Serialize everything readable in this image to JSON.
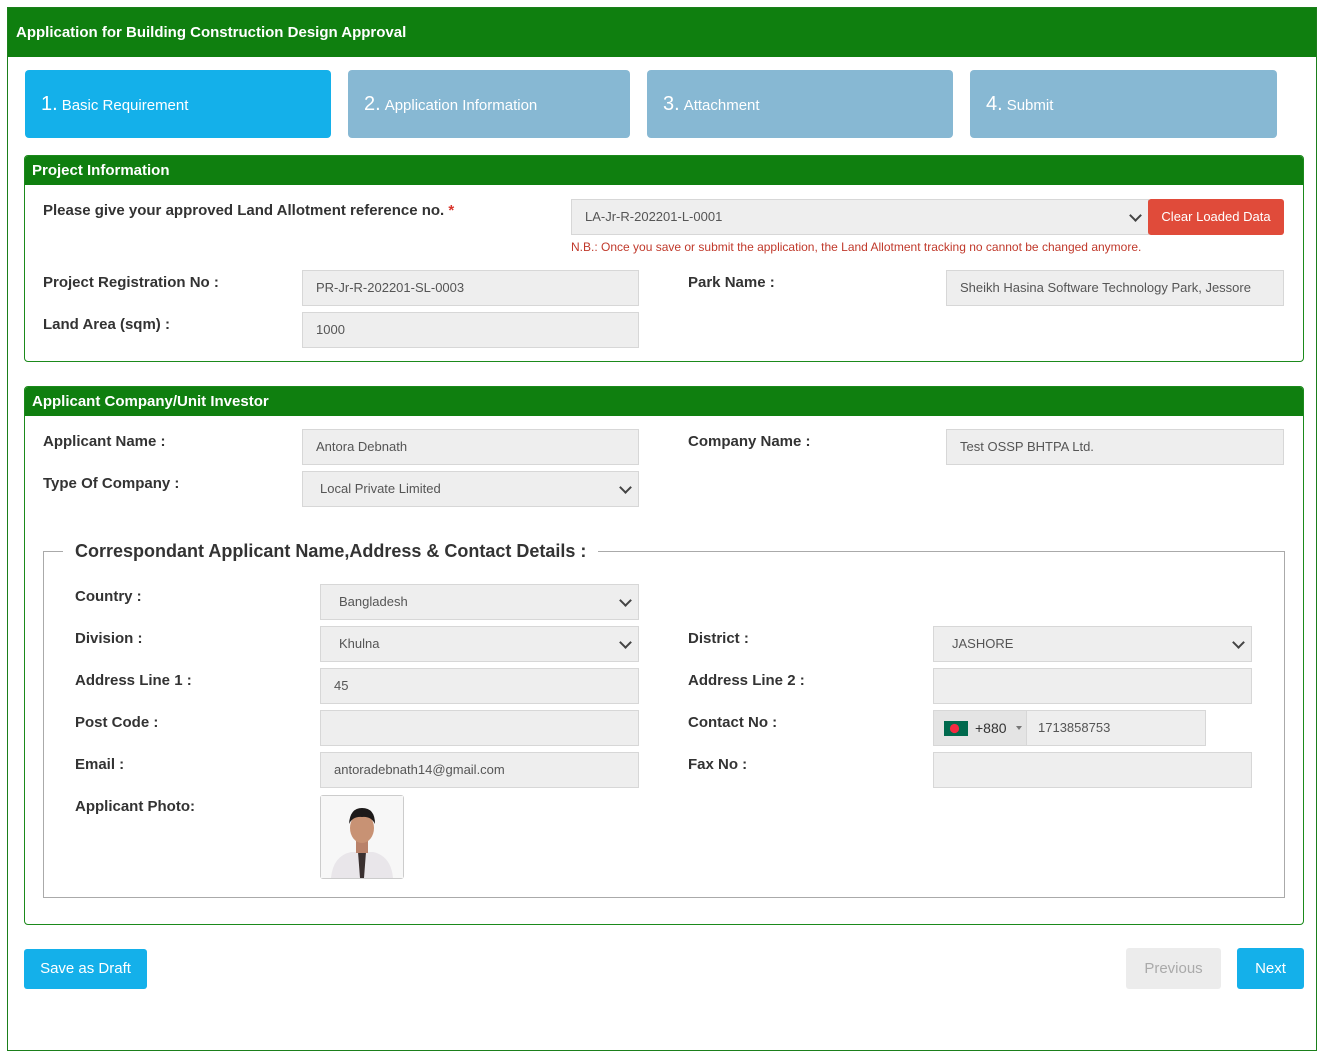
{
  "header": {
    "title": "Application for Building Construction Design Approval"
  },
  "steps": [
    {
      "num": "1.",
      "label": "Basic Requirement",
      "active": true
    },
    {
      "num": "2.",
      "label": "Application Information",
      "active": false
    },
    {
      "num": "3.",
      "label": "Attachment",
      "active": false
    },
    {
      "num": "4.",
      "label": "Submit",
      "active": false
    }
  ],
  "project": {
    "title": "Project Information",
    "land_ref_label": "Please give your approved Land Allotment reference no.",
    "required_mark": "*",
    "land_ref_value": "LA-Jr-R-202201-L-0001",
    "clear_button": "Clear Loaded Data",
    "note": "N.B.: Once you save or submit the application, the Land Allotment tracking no cannot be changed anymore.",
    "reg_no_label": "Project Registration No :",
    "reg_no_value": "PR-Jr-R-202201-SL-0003",
    "park_label": "Park Name :",
    "park_value": "Sheikh Hasina Software Technology Park, Jessore",
    "land_area_label": "Land Area (sqm) :",
    "land_area_value": "1000"
  },
  "applicant": {
    "title": "Applicant Company/Unit Investor",
    "name_label": "Applicant Name :",
    "name_value": "Antora Debnath",
    "company_label": "Company Name :",
    "company_value": "Test OSSP BHTPA Ltd.",
    "type_label": "Type Of Company :",
    "type_value": "Local Private Limited"
  },
  "correspondent": {
    "legend": "Correspondant Applicant Name,Address & Contact Details :",
    "country_label": "Country :",
    "country_value": "Bangladesh",
    "division_label": "Division :",
    "division_value": "Khulna",
    "district_label": "District :",
    "district_value": "JASHORE",
    "addr1_label": "Address Line 1 :",
    "addr1_value": "45",
    "addr2_label": "Address Line 2 :",
    "addr2_value": "",
    "postcode_label": "Post Code :",
    "postcode_value": "",
    "contact_label": "Contact No :",
    "dial_code": "+880",
    "contact_value": "1713858753",
    "email_label": "Email :",
    "email_value": "antoradebnath14@gmail.com",
    "fax_label": "Fax No :",
    "fax_value": "",
    "photo_label": "Applicant Photo:"
  },
  "footer": {
    "save_draft": "Save as Draft",
    "previous": "Previous",
    "next": "Next"
  },
  "colors": {
    "header_green": "#0f7f0f",
    "step_active": "#14b0ea",
    "step_inactive": "#87b8d3",
    "clear_button": "#e04b3a",
    "primary_button": "#14b0ea"
  }
}
